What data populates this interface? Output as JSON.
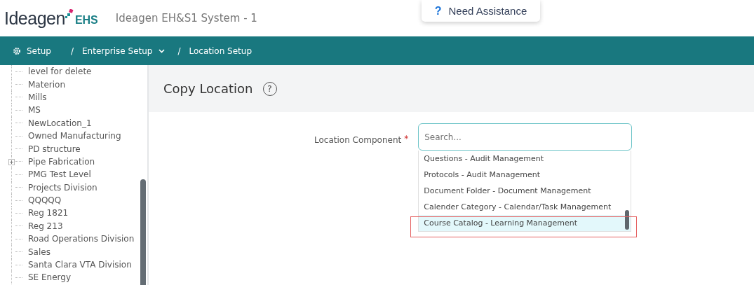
{
  "header": {
    "logo_word": "Ideagen",
    "logo_suffix": "EHS",
    "system_title": "Ideagen EH&S1 System - 1",
    "assistance": {
      "icon": "?",
      "label": "Need Assistance"
    }
  },
  "breadcrumb": [
    {
      "label": "Setup",
      "kind": "home"
    },
    {
      "separator": "/",
      "label": "Enterprise Setup",
      "kind": "menu"
    },
    {
      "separator": "/",
      "label": "Location Setup",
      "kind": "plain"
    }
  ],
  "sidebar": {
    "tree": [
      {
        "label": "level for delete",
        "collapsed": false
      },
      {
        "label": "Materion",
        "collapsed": false
      },
      {
        "label": "Mills",
        "collapsed": false
      },
      {
        "label": "MS",
        "collapsed": false
      },
      {
        "label": "NewLocation_1",
        "collapsed": false
      },
      {
        "label": "Owned Manufacturing",
        "collapsed": false
      },
      {
        "label": "PD structure",
        "collapsed": false
      },
      {
        "label": "Pipe Fabrication",
        "collapsed": true
      },
      {
        "label": "PMG Test Level",
        "collapsed": false
      },
      {
        "label": "Projects Division",
        "collapsed": false
      },
      {
        "label": "QQQQQ",
        "collapsed": false
      },
      {
        "label": "Reg 1821",
        "collapsed": false
      },
      {
        "label": "Reg 213",
        "collapsed": false
      },
      {
        "label": "Road Operations Division",
        "collapsed": false
      },
      {
        "label": "Sales",
        "collapsed": false
      },
      {
        "label": "Santa Clara VTA Division",
        "collapsed": false
      },
      {
        "label": "SE Energy",
        "collapsed": false
      }
    ]
  },
  "page": {
    "title": "Copy Location",
    "help_icon": "?"
  },
  "form": {
    "label": "Location Component",
    "required_mark": "*",
    "search": {
      "placeholder": "Search..."
    },
    "options": [
      {
        "label": "Questions - Audit Management",
        "selected": false
      },
      {
        "label": "Protocols - Audit Management",
        "selected": false
      },
      {
        "label": "Document Folder - Document Management",
        "selected": false
      },
      {
        "label": "Calender Category - Calendar/Task Management",
        "selected": false
      },
      {
        "label": "Course Catalog - Learning Management",
        "selected": true
      }
    ]
  }
}
